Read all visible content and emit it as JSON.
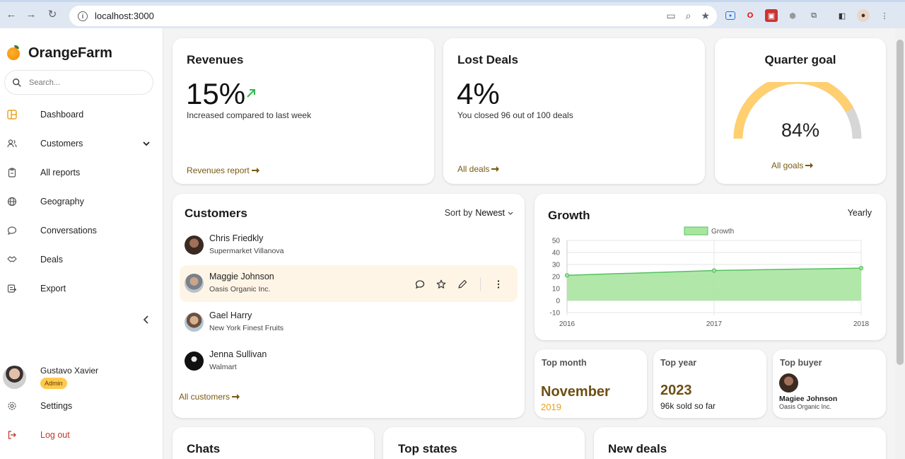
{
  "browser": {
    "url": "localhost:3000"
  },
  "brand": {
    "name": "OrangeFarm"
  },
  "search": {
    "placeholder": "Search..."
  },
  "sidebar": {
    "items": [
      {
        "label": "Dashboard",
        "icon": "dashboard-icon"
      },
      {
        "label": "Customers",
        "icon": "users-icon"
      },
      {
        "label": "All reports",
        "icon": "clipboard-icon"
      },
      {
        "label": "Geography",
        "icon": "globe-icon"
      },
      {
        "label": "Conversations",
        "icon": "chat-icon"
      },
      {
        "label": "Deals",
        "icon": "deals-icon"
      },
      {
        "label": "Export",
        "icon": "export-icon"
      }
    ],
    "user": {
      "name": "Gustavo Xavier",
      "role": "Admin"
    },
    "settings": "Settings",
    "logout": "Log out"
  },
  "revenues": {
    "title": "Revenues",
    "value": "15%",
    "subtitle": "Increased compared to last week",
    "link": "Revenues report"
  },
  "lost_deals": {
    "title": "Lost Deals",
    "value": "4%",
    "subtitle": "You closed 96 out of 100 deals",
    "link": "All deals"
  },
  "quarter_goal": {
    "title": "Quarter goal",
    "value": "84%",
    "progress": 0.84,
    "link": "All goals"
  },
  "customers": {
    "title": "Customers",
    "sort_label": "Sort by",
    "sort_value": "Newest",
    "list": [
      {
        "name": "Chris Friedkly",
        "company": "Supermarket Villanova"
      },
      {
        "name": "Maggie Johnson",
        "company": "Oasis Organic Inc."
      },
      {
        "name": "Gael Harry",
        "company": "New York Finest Fruits"
      },
      {
        "name": "Jenna Sullivan",
        "company": "Walmart"
      }
    ],
    "link": "All customers"
  },
  "growth": {
    "title": "Growth",
    "period": "Yearly"
  },
  "chart_data": {
    "type": "area",
    "x": [
      "2016",
      "2017",
      "2018"
    ],
    "series": [
      {
        "name": "Growth",
        "values": [
          21,
          25,
          27
        ]
      }
    ],
    "ylim": [
      -10,
      50
    ],
    "yticks": [
      "50",
      "40",
      "30",
      "20",
      "10",
      "0",
      "-10"
    ],
    "grid": true,
    "legend": "top-center",
    "colors": {
      "fill": "#a8e6a0",
      "stroke": "#55c060"
    }
  },
  "top_month": {
    "title": "Top month",
    "month": "November",
    "year": "2019"
  },
  "top_year": {
    "title": "Top year",
    "year": "2023",
    "subtitle": "96k sold so far"
  },
  "top_buyer": {
    "title": "Top buyer",
    "name": "Magiee Johnson",
    "company": "Oasis Organic Inc."
  },
  "bottom": {
    "chats": "Chats",
    "top_states": "Top states",
    "new_deals": "New deals"
  },
  "colors": {
    "accent": "#ffc94d",
    "link": "#7a5a14",
    "highlight": "#fff5e6",
    "gauge_fill": "#ffcf70",
    "gauge_track": "#d6d6d6"
  }
}
